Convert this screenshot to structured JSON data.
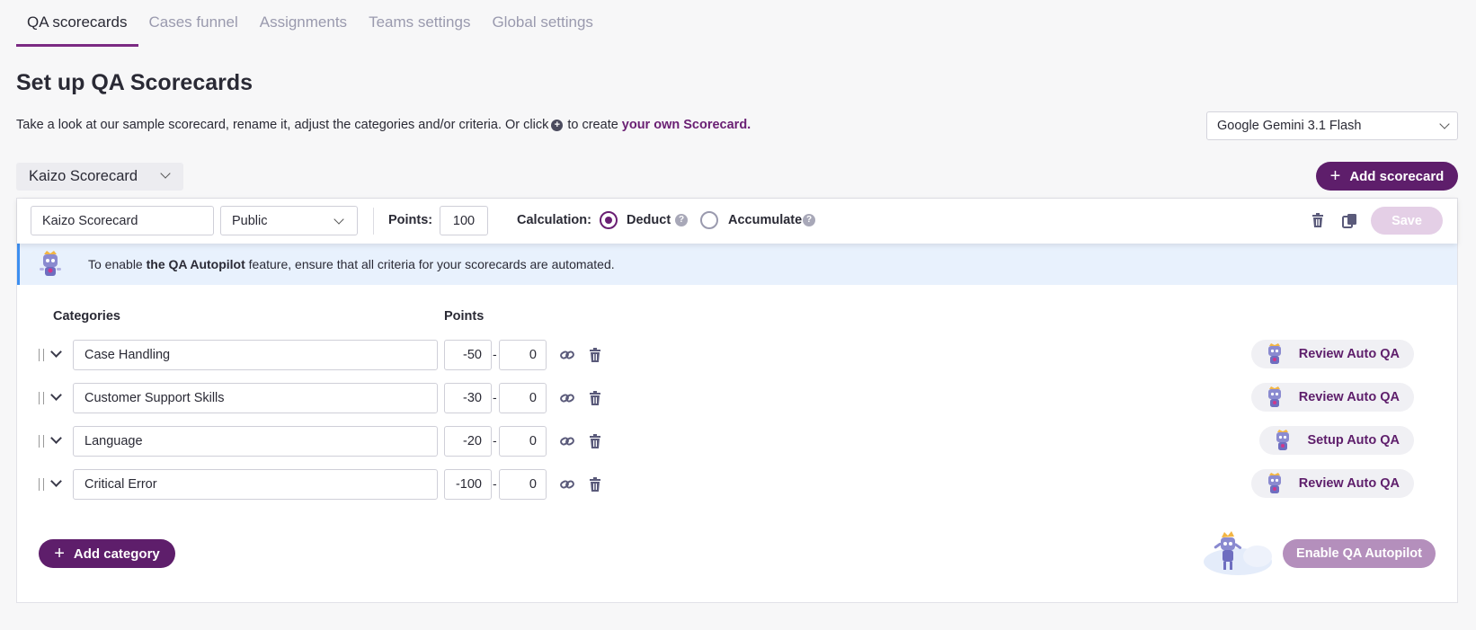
{
  "tabs": [
    {
      "label": "QA scorecards",
      "active": true
    },
    {
      "label": "Cases funnel",
      "active": false
    },
    {
      "label": "Assignments",
      "active": false
    },
    {
      "label": "Teams settings",
      "active": false
    },
    {
      "label": "Global settings",
      "active": false
    }
  ],
  "page": {
    "title": "Set up QA Scorecards",
    "subtitle_before": "Take a look at our sample scorecard, rename it, adjust the categories and/or criteria. Or click",
    "subtitle_icon": "plus-circle-icon",
    "subtitle_after": "to create",
    "subtitle_link": "your own Scorecard."
  },
  "model_select": {
    "value": "Google Gemini 3.1 Flash"
  },
  "scorecard_picker": {
    "value": "Kaizo Scorecard"
  },
  "add_scorecard_label": "Add scorecard",
  "toolbar": {
    "name_value": "Kaizo Scorecard",
    "visibility_value": "Public",
    "points_label": "Points:",
    "points_value": "100",
    "calculation_label": "Calculation:",
    "options": [
      {
        "label": "Deduct",
        "selected": true
      },
      {
        "label": "Accumulate",
        "selected": false
      }
    ],
    "help_glyph": "?",
    "save_label": "Save"
  },
  "banner": {
    "text_before": "To enable ",
    "text_bold": "the QA Autopilot",
    "text_after": " feature, ensure that all criteria for your scorecards are automated."
  },
  "columns": {
    "categories": "Categories",
    "points": "Points"
  },
  "categories": [
    {
      "name": "Case Handling",
      "min": "-50",
      "max": "0",
      "auto_label": "Review Auto QA"
    },
    {
      "name": "Customer Support Skills",
      "min": "-30",
      "max": "0",
      "auto_label": "Review Auto QA"
    },
    {
      "name": "Language",
      "min": "-20",
      "max": "0",
      "auto_label": "Setup Auto QA"
    },
    {
      "name": "Critical Error",
      "min": "-100",
      "max": "0",
      "auto_label": "Review Auto QA"
    }
  ],
  "add_category_label": "Add category",
  "enable_autopilot_label": "Enable QA Autopilot",
  "colors": {
    "brand": "#5e1e6b",
    "accent": "#6a1f73",
    "banner_bg": "#e8f1fd",
    "banner_border": "#3d8ff0"
  }
}
